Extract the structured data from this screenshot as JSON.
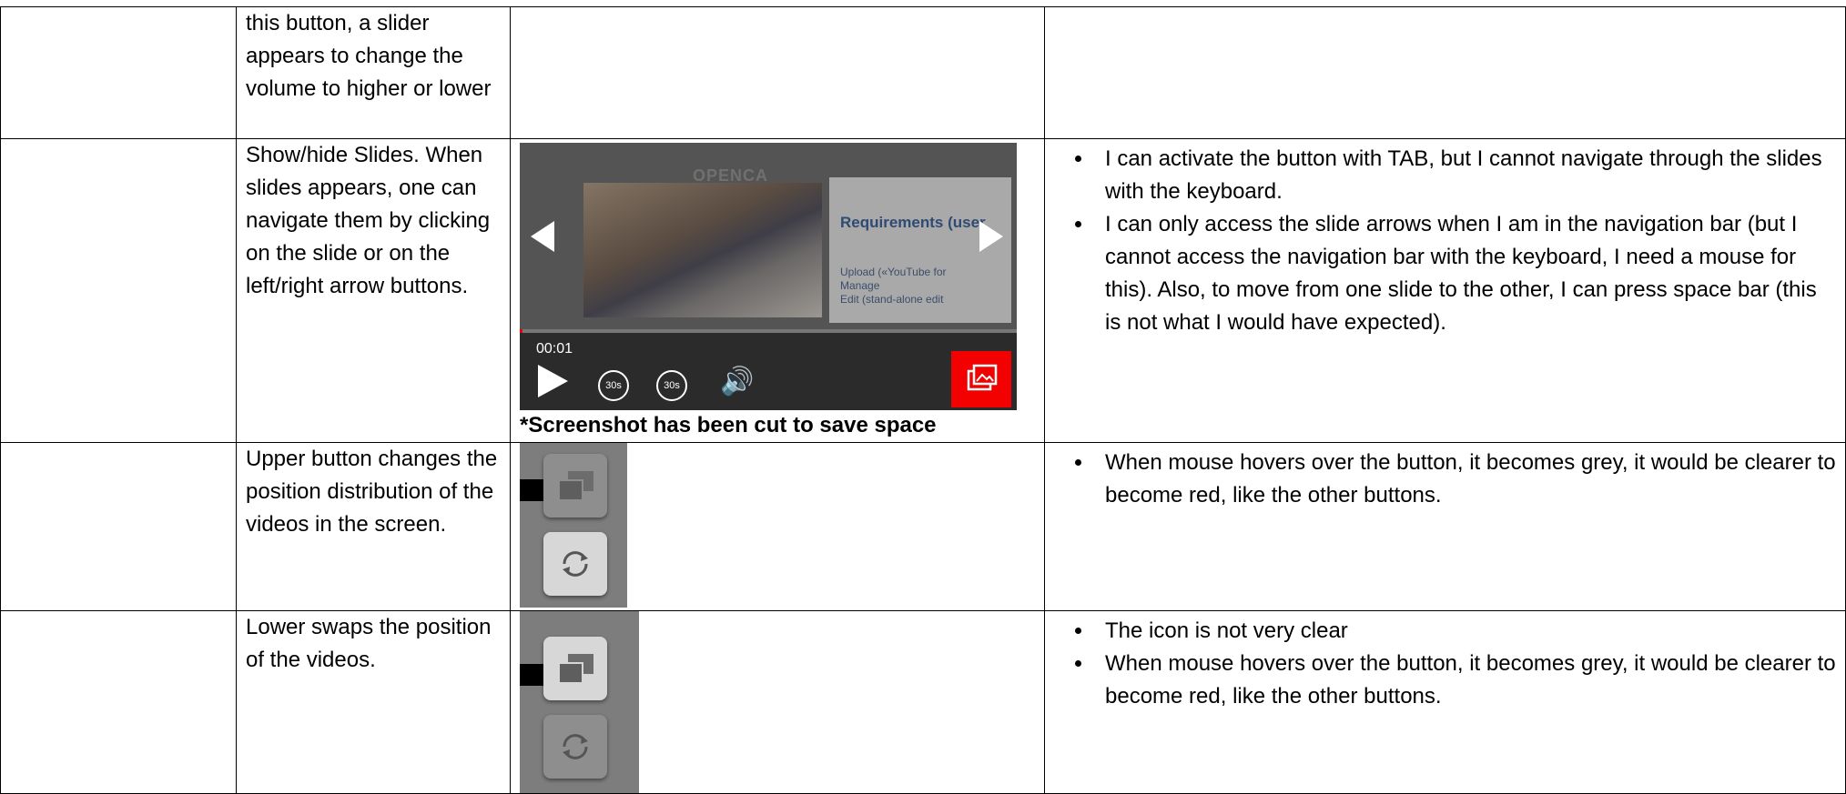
{
  "rows": [
    {
      "description": "this button, a slider appears to change the volume to higher or lower",
      "notes": []
    },
    {
      "description": "Show/hide Slides. When slides appears, one can navigate them by clicking on the slide or on the left/right arrow buttons.",
      "caption": "*Screenshot has been cut to save space",
      "notes": [
        "I can activate the button with TAB, but I cannot navigate through the slides with the keyboard.",
        "I can only access the slide arrows when I am in the navigation bar (but I cannot access the navigation bar with the keyboard, I need a mouse for this). Also, to move from one slide to the other, I can press space bar (this is not what I would have expected)."
      ]
    },
    {
      "description": "Upper button changes the position distribution of the videos in the screen.",
      "notes": [
        "When mouse hovers over the button, it becomes grey, it would be clearer to become red, like the other buttons."
      ]
    },
    {
      "description": "Lower swaps the position of the videos.",
      "notes": [
        "The icon is not very clear",
        "When mouse hovers over the button, it becomes grey, it would be clearer to become red, like the other buttons."
      ]
    }
  ],
  "player": {
    "time": "00:01",
    "skip_back_label": "30s",
    "skip_forward_label": "30s",
    "slide_logo": "OPENCA",
    "slide_heading": "Requirements (user",
    "slide_bullets": [
      "Upload («YouTube for",
      "Manage",
      "Edit (stand-alone edit"
    ],
    "progress_fraction": 0.005,
    "accent_color": "#f30000",
    "icons": [
      "play-icon",
      "rewind-30-icon",
      "forward-30-icon",
      "volume-icon",
      "slides-icon",
      "arrow-left-icon",
      "arrow-right-icon"
    ]
  },
  "layout_buttons": {
    "icons": [
      "layout-position-icon",
      "swap-videos-icon"
    ]
  }
}
